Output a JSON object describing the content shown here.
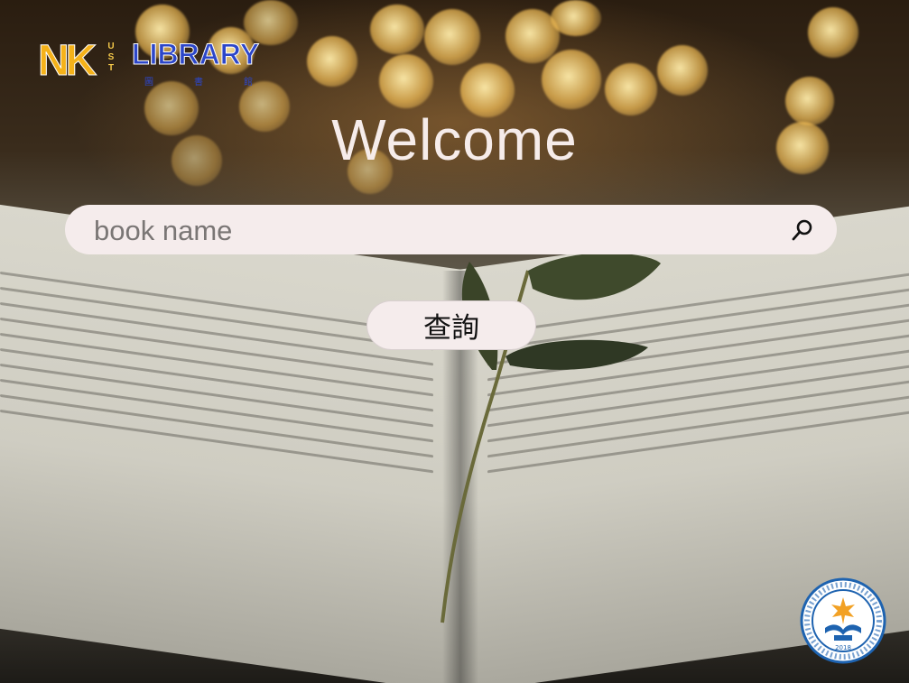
{
  "logo": {
    "nk": "NK",
    "ust": [
      "U",
      "S",
      "T"
    ],
    "library": "LIBRARY",
    "zh": [
      "圖",
      "書",
      "館"
    ]
  },
  "title": "Welcome",
  "search": {
    "placeholder": "book name",
    "value": "",
    "icon": "search-icon"
  },
  "query_button": {
    "label": "查詢"
  },
  "seal": {
    "year": "2018"
  },
  "colors": {
    "input_bg": "#f5ecec",
    "title": "#f6ecea",
    "logo_orange": "#f5b21a",
    "logo_blue": "#2c46c9"
  }
}
